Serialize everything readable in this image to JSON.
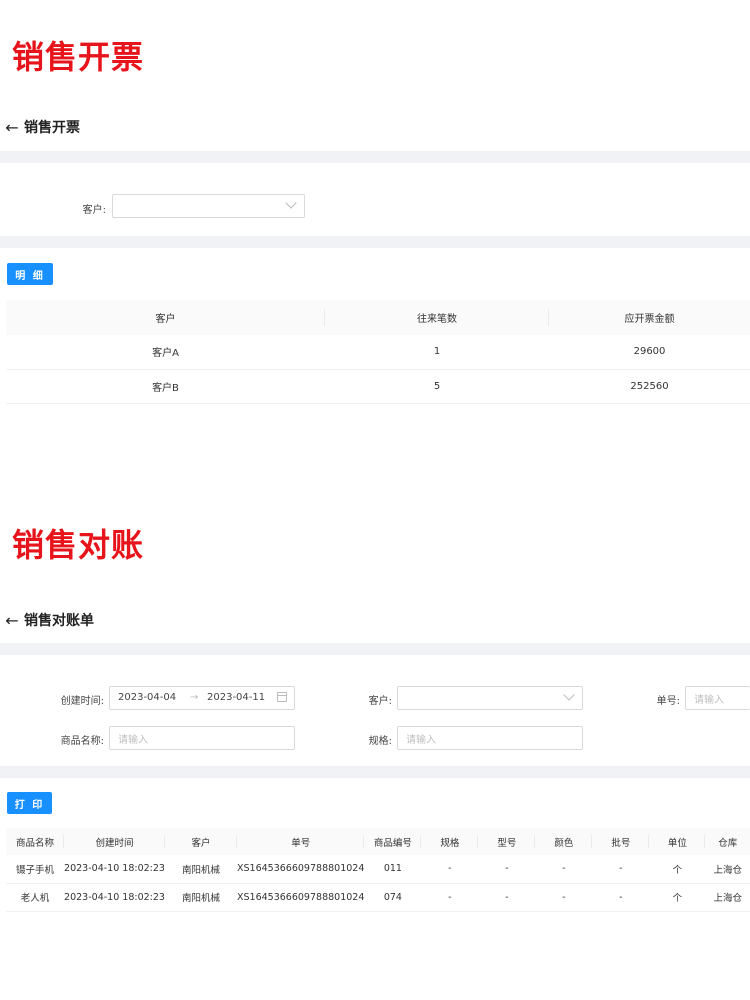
{
  "section1": {
    "big_title": "销售开票",
    "header_title": "销售开票",
    "filter": {
      "customer_label": "客户:",
      "customer_value": ""
    },
    "detail_button": "明 细",
    "table": {
      "columns": [
        "客户",
        "往来笔数",
        "应开票金额"
      ],
      "rows": [
        [
          "客户A",
          "1",
          "29600"
        ],
        [
          "客户B",
          "5",
          "252560"
        ]
      ]
    }
  },
  "section2": {
    "big_title": "销售对账",
    "header_title": "销售对账单",
    "filter": {
      "created_label": "创建时间:",
      "date_start": "2023-04-04",
      "date_sep": "→",
      "date_end": "2023-04-11",
      "customer_label": "客户:",
      "order_no_label": "单号:",
      "order_no_placeholder": "请输入",
      "product_name_label": "商品名称:",
      "product_name_placeholder": "请输入",
      "spec_label": "规格:",
      "spec_placeholder": "请输入"
    },
    "print_button": "打 印",
    "table": {
      "columns": [
        "商品名称",
        "创建时间",
        "客户",
        "单号",
        "商品编号",
        "规格",
        "型号",
        "颜色",
        "批号",
        "单位",
        "仓库"
      ],
      "rows": [
        [
          "镊子手机",
          "2023-04-10 18:02:23",
          "南阳机械",
          "XS1645366609788801024",
          "011",
          "-",
          "-",
          "-",
          "-",
          "个",
          "上海仓"
        ],
        [
          "老人机",
          "2023-04-10 18:02:23",
          "南阳机械",
          "XS1645366609788801024",
          "074",
          "-",
          "-",
          "-",
          "-",
          "个",
          "上海仓"
        ]
      ]
    }
  },
  "icons": {
    "back": "arrow-left-icon",
    "dropdown": "chevron-down-icon",
    "calendar": "calendar-icon"
  },
  "colors": {
    "title_red": "#e8141b",
    "primary": "#1890ff",
    "band": "#f0f2f5"
  }
}
